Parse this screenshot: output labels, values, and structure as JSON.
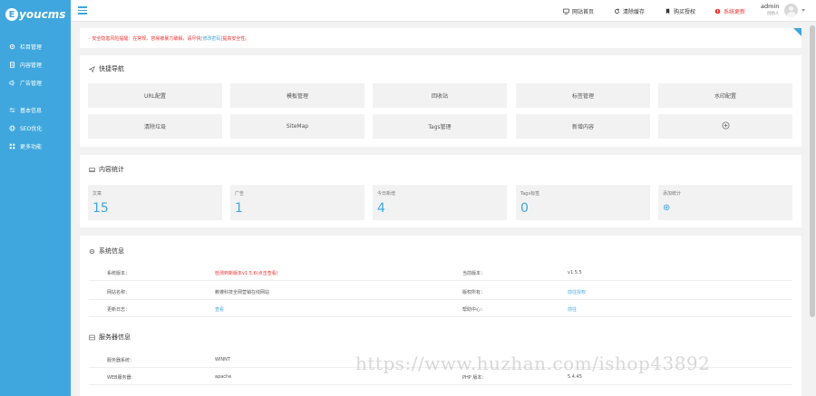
{
  "logo": {
    "mark": "E",
    "text": "youcms"
  },
  "sidebar": {
    "items": [
      {
        "label": "栏目管理",
        "icon": "gear-icon"
      },
      {
        "label": "内容管理",
        "icon": "document-icon"
      },
      {
        "label": "广告管理",
        "icon": "megaphone-icon"
      },
      {
        "label": "基本信息",
        "icon": "sliders-icon"
      },
      {
        "label": "SEO优化",
        "icon": "globe-icon"
      },
      {
        "label": "更多功能",
        "icon": "grid-icon"
      }
    ]
  },
  "topbar": {
    "links": [
      {
        "label": "网站首页",
        "icon": "monitor-icon",
        "color": "#333333"
      },
      {
        "label": "清除缓存",
        "icon": "refresh-icon",
        "color": "#333333"
      },
      {
        "label": "购买授权",
        "icon": "bookmark-icon",
        "color": "#333333"
      },
      {
        "label": "系统更新",
        "icon": "alert-icon",
        "color": "#e33333"
      }
    ],
    "user": {
      "name": "admin",
      "role": "创始人"
    }
  },
  "warning": {
    "text": "- 安全隐患风险提醒：在常规、容易被暴力破解，请尽快",
    "link": "[修改密码]",
    "suffix": "提高安全性。"
  },
  "quick_nav": {
    "title": "快捷导航",
    "items": [
      "URL配置",
      "模板管理",
      "回收站",
      "标签管理",
      "水印配置",
      "清除垃圾",
      "SiteMap",
      "Tags管理",
      "新增内容",
      ""
    ]
  },
  "stats": {
    "title": "内容统计",
    "items": [
      {
        "label": "文章",
        "value": "15"
      },
      {
        "label": "广告",
        "value": "1"
      },
      {
        "label": "今日新增",
        "value": "4"
      },
      {
        "label": "Tags标签",
        "value": "0"
      },
      {
        "label": "添加统计",
        "value": "⊕"
      }
    ]
  },
  "system_info": {
    "title": "系统信息",
    "rows": [
      {
        "k1": "系统版本：",
        "v1": "检测到新版本v1.5.6(点击查看)",
        "k2": "当前版本：",
        "v2": "v1.5.5"
      },
      {
        "k1": "网站名称：",
        "v1": "赖遵科技全网营销在线网站",
        "k2": "版权所有：",
        "v2": "前往授权"
      },
      {
        "k1": "更新日志：",
        "v1": "查看",
        "k2": "帮助中心：",
        "v2": "前往"
      }
    ]
  },
  "server_info": {
    "title": "服务器信息",
    "rows": [
      {
        "k1": "服务器系统：",
        "v1": "WINNT",
        "k2": "",
        "v2": ""
      },
      {
        "k1": "WEB服务器：",
        "v1": "apache",
        "k2": "PHP 版本：",
        "v2": "5.4.45"
      }
    ]
  },
  "watermark": "https://www.huzhan.com/ishop43892",
  "colors": {
    "accent": "#3fa7dd",
    "warning": "#e33333",
    "background": "#f2f2f2"
  }
}
